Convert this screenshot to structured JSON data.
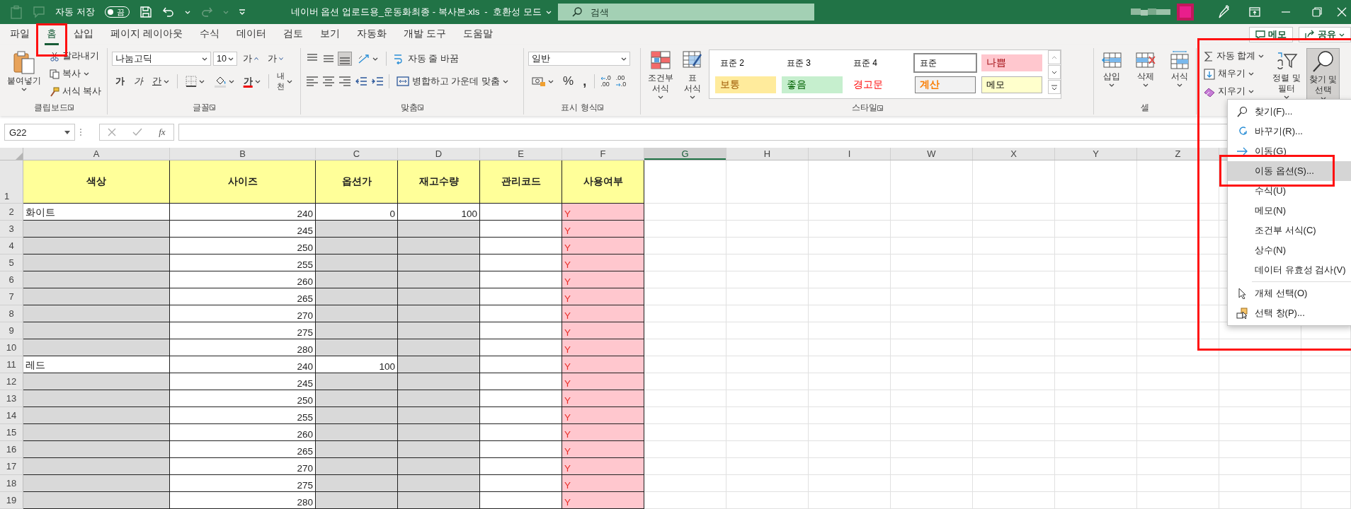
{
  "title_bar": {
    "autosave": {
      "label": "자동 저장",
      "state_text": "끔",
      "on": false
    },
    "title": "네이버 옵션 업로드용_운동화최종 - 복사본.xls  -  호환성 모드",
    "search": {
      "placeholder": "검색"
    }
  },
  "ribbon_tabs": [
    {
      "label": "파일",
      "selected": false,
      "marked": false
    },
    {
      "label": "홈",
      "selected": true,
      "marked": true
    },
    {
      "label": "삽입",
      "selected": false,
      "marked": false
    },
    {
      "label": "페이지 레이아웃",
      "selected": false,
      "marked": false
    },
    {
      "label": "수식",
      "selected": false,
      "marked": false
    },
    {
      "label": "데이터",
      "selected": false,
      "marked": false
    },
    {
      "label": "검토",
      "selected": false,
      "marked": false
    },
    {
      "label": "보기",
      "selected": false,
      "marked": false
    },
    {
      "label": "자동화",
      "selected": false,
      "marked": false
    },
    {
      "label": "개발 도구",
      "selected": false,
      "marked": false
    },
    {
      "label": "도움말",
      "selected": false,
      "marked": false
    }
  ],
  "header_buttons": [
    {
      "kind": "comment",
      "label": "메모"
    },
    {
      "kind": "share",
      "label": "공유"
    }
  ],
  "clipboard": {
    "paste": "붙여넣기",
    "cut": "잘라내기",
    "copy": "복사",
    "format_painter": "서식 복사",
    "label": "클립보드"
  },
  "font": {
    "name": "나눔고딕",
    "size": "10",
    "grow": "가",
    "shrink": "가",
    "bold": "가",
    "italic": "가",
    "underline": "간",
    "font_color": "가",
    "phonetic": "내천",
    "label": "글꼴"
  },
  "alignment": {
    "wrap": "자동 줄 바꿈",
    "merge": "병합하고 가운데 맞춤",
    "label": "맞춤"
  },
  "number": {
    "format": "일반",
    "percent": "%",
    "comma": ",",
    "increase_decimal": [
      ".0",
      ".00"
    ],
    "decrease_decimal": [
      ".00",
      ".0"
    ],
    "label": "표시 형식"
  },
  "styles": {
    "conditional": "조건부\n서식",
    "table": "표\n서식",
    "label": "스타일",
    "cells": [
      {
        "label": "표준 2",
        "kind": "plain",
        "selected": false
      },
      {
        "label": "표준 3",
        "kind": "plain",
        "selected": false
      },
      {
        "label": "표준 4",
        "kind": "plain",
        "selected": false
      },
      {
        "label": "표준",
        "kind": "plain",
        "selected": true
      },
      {
        "label": "나쁨",
        "kind": "bad",
        "selected": false
      },
      {
        "label": "보통",
        "kind": "neutral",
        "selected": false
      },
      {
        "label": "좋음",
        "kind": "good",
        "selected": false
      },
      {
        "label": "경고문",
        "kind": "warning",
        "selected": false
      },
      {
        "label": "계산",
        "kind": "calc",
        "selected": false
      },
      {
        "label": "메모",
        "kind": "note",
        "selected": false
      }
    ]
  },
  "cells_group": {
    "label": "셀",
    "buttons": [
      {
        "kind": "insert",
        "label": "삽입"
      },
      {
        "kind": "delete",
        "label": "삭제"
      },
      {
        "kind": "format",
        "label": "서식"
      }
    ]
  },
  "editing": {
    "marked": true,
    "autosum": "자동 합계",
    "fill": "채우기",
    "clear": "지우기",
    "sort_filter": "정렬 및\n필터",
    "find_select": {
      "label": "찾기 및\n선택",
      "pressed": true
    }
  },
  "formula_bar": {
    "name_box": "G22",
    "function_label": "fx"
  },
  "sheet": {
    "columns": [
      {
        "label": "A",
        "selected": false
      },
      {
        "label": "B",
        "selected": false
      },
      {
        "label": "C",
        "selected": false
      },
      {
        "label": "D",
        "selected": false
      },
      {
        "label": "E",
        "selected": false
      },
      {
        "label": "F",
        "selected": false
      },
      {
        "label": "G",
        "selected": true
      },
      {
        "label": "H",
        "selected": false
      },
      {
        "label": "I",
        "selected": false
      },
      {
        "label": "W",
        "selected": false
      },
      {
        "label": "X",
        "selected": false
      },
      {
        "label": "Y",
        "selected": false
      },
      {
        "label": "Z",
        "selected": false
      }
    ],
    "rows": [
      {
        "number": "1",
        "cells": [
          {
            "kind": "header",
            "text": "색상"
          },
          {
            "kind": "header",
            "text": "사이즈"
          },
          {
            "kind": "header",
            "text": "옵션가"
          },
          {
            "kind": "header",
            "text": "재고수량"
          },
          {
            "kind": "header",
            "text": "관리코드"
          },
          {
            "kind": "header",
            "text": "사용여부"
          }
        ]
      },
      {
        "number": "2",
        "cells": [
          {
            "kind": "text",
            "text": "화이트"
          },
          {
            "kind": "number",
            "text": "240"
          },
          {
            "kind": "number",
            "text": "0"
          },
          {
            "kind": "number",
            "text": "100"
          },
          {
            "kind": "blank"
          },
          {
            "kind": "flag",
            "text": "Y"
          }
        ]
      },
      {
        "number": "3",
        "cells": [
          {
            "kind": "filled"
          },
          {
            "kind": "number",
            "text": "245"
          },
          {
            "kind": "filled"
          },
          {
            "kind": "filled"
          },
          {
            "kind": "blank"
          },
          {
            "kind": "flag",
            "text": "Y"
          }
        ]
      },
      {
        "number": "4",
        "cells": [
          {
            "kind": "filled"
          },
          {
            "kind": "number",
            "text": "250"
          },
          {
            "kind": "filled"
          },
          {
            "kind": "filled"
          },
          {
            "kind": "blank"
          },
          {
            "kind": "flag",
            "text": "Y"
          }
        ]
      },
      {
        "number": "5",
        "cells": [
          {
            "kind": "filled"
          },
          {
            "kind": "number",
            "text": "255"
          },
          {
            "kind": "filled"
          },
          {
            "kind": "filled"
          },
          {
            "kind": "blank"
          },
          {
            "kind": "flag",
            "text": "Y"
          }
        ]
      },
      {
        "number": "6",
        "cells": [
          {
            "kind": "filled"
          },
          {
            "kind": "number",
            "text": "260"
          },
          {
            "kind": "filled"
          },
          {
            "kind": "filled"
          },
          {
            "kind": "blank"
          },
          {
            "kind": "flag",
            "text": "Y"
          }
        ]
      },
      {
        "number": "7",
        "cells": [
          {
            "kind": "filled"
          },
          {
            "kind": "number",
            "text": "265"
          },
          {
            "kind": "filled"
          },
          {
            "kind": "filled"
          },
          {
            "kind": "blank"
          },
          {
            "kind": "flag",
            "text": "Y"
          }
        ]
      },
      {
        "number": "8",
        "cells": [
          {
            "kind": "filled"
          },
          {
            "kind": "number",
            "text": "270"
          },
          {
            "kind": "filled"
          },
          {
            "kind": "filled"
          },
          {
            "kind": "blank"
          },
          {
            "kind": "flag",
            "text": "Y"
          }
        ]
      },
      {
        "number": "9",
        "cells": [
          {
            "kind": "filled"
          },
          {
            "kind": "number",
            "text": "275"
          },
          {
            "kind": "filled"
          },
          {
            "kind": "filled"
          },
          {
            "kind": "blank"
          },
          {
            "kind": "flag",
            "text": "Y"
          }
        ]
      },
      {
        "number": "10",
        "cells": [
          {
            "kind": "filled"
          },
          {
            "kind": "number",
            "text": "280"
          },
          {
            "kind": "filled"
          },
          {
            "kind": "filled"
          },
          {
            "kind": "blank"
          },
          {
            "kind": "flag",
            "text": "Y"
          }
        ]
      },
      {
        "number": "11",
        "cells": [
          {
            "kind": "text",
            "text": "레드"
          },
          {
            "kind": "number",
            "text": "240"
          },
          {
            "kind": "number",
            "text": "100"
          },
          {
            "kind": "filled"
          },
          {
            "kind": "blank"
          },
          {
            "kind": "flag",
            "text": "Y"
          }
        ]
      },
      {
        "number": "12",
        "cells": [
          {
            "kind": "filled"
          },
          {
            "kind": "number",
            "text": "245"
          },
          {
            "kind": "filled"
          },
          {
            "kind": "filled"
          },
          {
            "kind": "blank"
          },
          {
            "kind": "flag",
            "text": "Y"
          }
        ]
      },
      {
        "number": "13",
        "cells": [
          {
            "kind": "filled"
          },
          {
            "kind": "number",
            "text": "250"
          },
          {
            "kind": "filled"
          },
          {
            "kind": "filled"
          },
          {
            "kind": "blank"
          },
          {
            "kind": "flag",
            "text": "Y"
          }
        ]
      },
      {
        "number": "14",
        "cells": [
          {
            "kind": "filled"
          },
          {
            "kind": "number",
            "text": "255"
          },
          {
            "kind": "filled"
          },
          {
            "kind": "filled"
          },
          {
            "kind": "blank"
          },
          {
            "kind": "flag",
            "text": "Y"
          }
        ]
      },
      {
        "number": "15",
        "cells": [
          {
            "kind": "filled"
          },
          {
            "kind": "number",
            "text": "260"
          },
          {
            "kind": "filled"
          },
          {
            "kind": "filled"
          },
          {
            "kind": "blank"
          },
          {
            "kind": "flag",
            "text": "Y"
          }
        ]
      },
      {
        "number": "16",
        "cells": [
          {
            "kind": "filled"
          },
          {
            "kind": "number",
            "text": "265"
          },
          {
            "kind": "filled"
          },
          {
            "kind": "filled"
          },
          {
            "kind": "blank"
          },
          {
            "kind": "flag",
            "text": "Y"
          }
        ]
      },
      {
        "number": "17",
        "cells": [
          {
            "kind": "filled"
          },
          {
            "kind": "number",
            "text": "270"
          },
          {
            "kind": "filled"
          },
          {
            "kind": "filled"
          },
          {
            "kind": "blank"
          },
          {
            "kind": "flag",
            "text": "Y"
          }
        ]
      },
      {
        "number": "18",
        "cells": [
          {
            "kind": "filled"
          },
          {
            "kind": "number",
            "text": "275"
          },
          {
            "kind": "filled"
          },
          {
            "kind": "filled"
          },
          {
            "kind": "blank"
          },
          {
            "kind": "flag",
            "text": "Y"
          }
        ]
      },
      {
        "number": "19",
        "cells": [
          {
            "kind": "filled"
          },
          {
            "kind": "number",
            "text": "280"
          },
          {
            "kind": "filled"
          },
          {
            "kind": "filled"
          },
          {
            "kind": "blank"
          },
          {
            "kind": "flag",
            "text": "Y"
          }
        ]
      }
    ]
  },
  "find_menu": {
    "items": [
      {
        "kind": "find",
        "label": "찾기(F)...",
        "selected": false,
        "marked": false,
        "separator_before": false
      },
      {
        "kind": "replace",
        "label": "바꾸기(R)...",
        "selected": false,
        "marked": false,
        "separator_before": false
      },
      {
        "kind": "goto",
        "label": "이동(G)",
        "selected": false,
        "marked": false,
        "separator_before": false
      },
      {
        "kind": "plain",
        "label": "이동 옵션(S)...",
        "selected": true,
        "marked": true,
        "separator_before": false
      },
      {
        "kind": "plain",
        "label": "수식(U)",
        "selected": false,
        "marked": false,
        "separator_before": false
      },
      {
        "kind": "plain",
        "label": "메모(N)",
        "selected": false,
        "marked": false,
        "separator_before": false
      },
      {
        "kind": "plain",
        "label": "조건부 서식(C)",
        "selected": false,
        "marked": false,
        "separator_before": false
      },
      {
        "kind": "plain",
        "label": "상수(N)",
        "selected": false,
        "marked": false,
        "separator_before": false
      },
      {
        "kind": "plain",
        "label": "데이터 유효성 검사(V)",
        "selected": false,
        "marked": false,
        "separator_before": false
      },
      {
        "kind": "pointer",
        "label": "개체 선택(O)",
        "selected": false,
        "marked": false,
        "separator_before": true
      },
      {
        "kind": "pane",
        "label": "선택 창(P)...",
        "selected": false,
        "marked": false,
        "separator_before": false
      }
    ]
  }
}
